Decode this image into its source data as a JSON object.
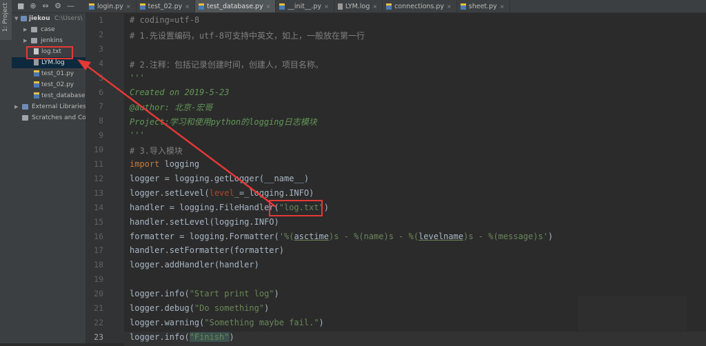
{
  "sidebar_strip": {
    "tab_label": "1: Project"
  },
  "toolbar": {
    "icons": [
      "folder-icon",
      "globe-icon",
      "collapse-icon",
      "gear-icon",
      "minimize-icon"
    ],
    "glyphs": [
      "■",
      "⊕",
      "⇔",
      "⚙",
      "—"
    ]
  },
  "project_tree": {
    "root": {
      "name": "jiekou",
      "path": "C:\\Users\\"
    },
    "items": [
      {
        "label": "case",
        "type": "folder"
      },
      {
        "label": "jenkins",
        "type": "folder"
      },
      {
        "label": "log.txt",
        "type": "txt"
      },
      {
        "label": "LYM.log",
        "type": "log"
      },
      {
        "label": "test_01.py",
        "type": "py"
      },
      {
        "label": "test_02.py",
        "type": "py"
      },
      {
        "label": "test_database",
        "type": "py"
      }
    ],
    "external": "External Libraries",
    "scratches": "Scratches and Co"
  },
  "tabs": [
    {
      "label": "login.py",
      "kind": "py"
    },
    {
      "label": "test_02.py",
      "kind": "py"
    },
    {
      "label": "test_database.py",
      "kind": "py",
      "active": true
    },
    {
      "label": "__init__.py",
      "kind": "py"
    },
    {
      "label": "LYM.log",
      "kind": "log"
    },
    {
      "label": "connections.py",
      "kind": "py"
    },
    {
      "label": "sheet.py",
      "kind": "py"
    }
  ],
  "tab_close": "×",
  "editor": {
    "current_line": 23,
    "lines": [
      {
        "n": 1,
        "parts": [
          [
            "c-com",
            "# coding=utf-8"
          ]
        ]
      },
      {
        "n": 2,
        "parts": [
          [
            "c-com",
            "# 1.先设置编码，utf-8可支持中英文，如上，一般放在第一行"
          ]
        ]
      },
      {
        "n": 3,
        "parts": []
      },
      {
        "n": 4,
        "parts": [
          [
            "c-com",
            "# 2.注释：包括记录创建时间，创建人，项目名称。"
          ]
        ]
      },
      {
        "n": 5,
        "parts": [
          [
            "c-doc",
            "'''"
          ]
        ]
      },
      {
        "n": 6,
        "parts": [
          [
            "c-doc",
            "Created on 2019-5-23"
          ]
        ]
      },
      {
        "n": 7,
        "parts": [
          [
            "c-doc",
            "@author: 北京-宏哥"
          ]
        ]
      },
      {
        "n": 8,
        "parts": [
          [
            "c-doc",
            "Project:学习和使用python的logging日志模块"
          ]
        ]
      },
      {
        "n": 9,
        "parts": [
          [
            "c-doc",
            "'''"
          ]
        ]
      },
      {
        "n": 10,
        "parts": [
          [
            "c-com",
            "# 3.导入模块"
          ]
        ]
      },
      {
        "n": 11,
        "parts": [
          [
            "c-kw",
            "import "
          ],
          [
            "",
            "logging"
          ]
        ]
      },
      {
        "n": 12,
        "parts": [
          [
            "",
            "logger = logging.getLogger(__name__)"
          ]
        ]
      },
      {
        "n": 13,
        "parts": [
          [
            "",
            "logger.setLevel("
          ],
          [
            "c-kwarg",
            "level"
          ],
          [
            "",
            "_=_logging.INFO)"
          ]
        ]
      },
      {
        "n": 14,
        "parts": [
          [
            "",
            "handler = logging.FileHandler("
          ],
          [
            "c-str",
            "\"log.txt\""
          ],
          [
            "",
            ")"
          ]
        ]
      },
      {
        "n": 15,
        "parts": [
          [
            "",
            "handler.setLevel(logging.INFO)"
          ]
        ]
      },
      {
        "n": 16,
        "parts": [
          [
            "",
            "formatter = logging.Formatter("
          ],
          [
            "c-str",
            "'%("
          ],
          [
            "c-fmt",
            "asctime"
          ],
          [
            "c-str",
            ")s - %(name)s - %("
          ],
          [
            "c-fmt",
            "levelname"
          ],
          [
            "c-str",
            ")s - %(message)s'"
          ],
          [
            "",
            ")"
          ]
        ]
      },
      {
        "n": 17,
        "parts": [
          [
            "",
            "handler.setFormatter(formatter)"
          ]
        ]
      },
      {
        "n": 18,
        "parts": [
          [
            "",
            "logger.addHandler(handler)"
          ]
        ]
      },
      {
        "n": 19,
        "parts": []
      },
      {
        "n": 20,
        "parts": [
          [
            "",
            "logger.info("
          ],
          [
            "c-str",
            "\"Start print log\""
          ],
          [
            "",
            ")"
          ]
        ]
      },
      {
        "n": 21,
        "parts": [
          [
            "",
            "logger.debug("
          ],
          [
            "c-str",
            "\"Do something\""
          ],
          [
            "",
            ")"
          ]
        ]
      },
      {
        "n": 22,
        "parts": [
          [
            "",
            "logger.warning("
          ],
          [
            "c-str",
            "\"Something maybe fail.\""
          ],
          [
            "",
            ")"
          ]
        ]
      },
      {
        "n": 23,
        "parts": [
          [
            "",
            "logger.info("
          ],
          [
            "c-str caret-bg",
            "\"Finish\""
          ],
          [
            "",
            ")"
          ]
        ]
      }
    ]
  },
  "colors": {
    "annotation": "#e53935",
    "background": "#2b2b2b",
    "panel": "#3c3f41"
  }
}
